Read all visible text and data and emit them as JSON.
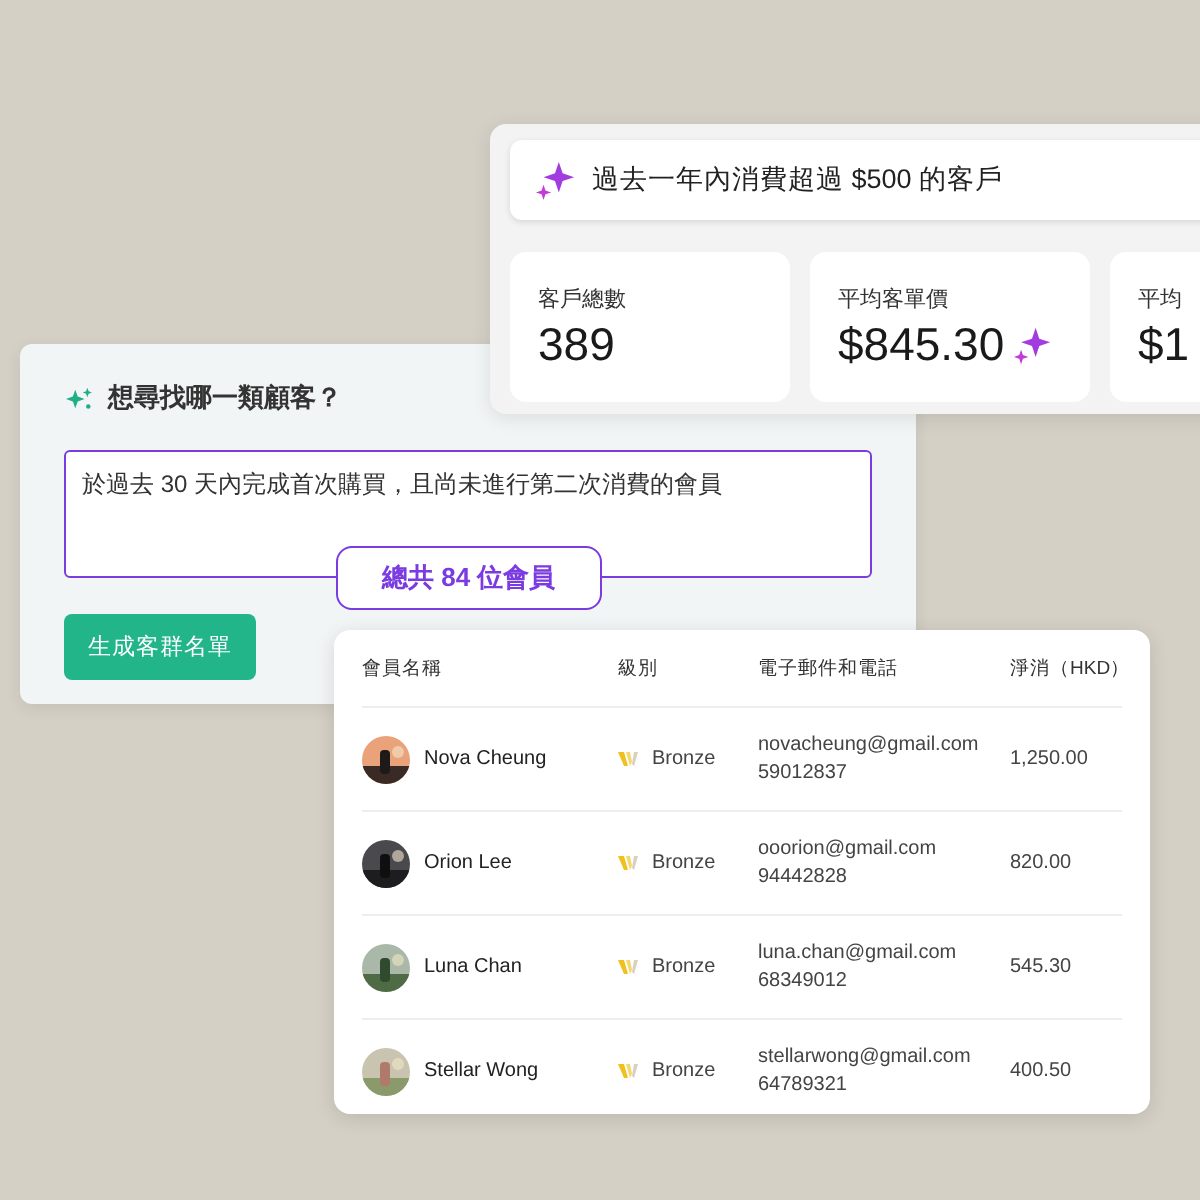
{
  "query_panel": {
    "query": "過去一年內消費超過 $500 的客戶",
    "stats": [
      {
        "label": "客戶總數",
        "value": "389",
        "sparkle": false
      },
      {
        "label": "平均客單價",
        "value": "$845.30",
        "sparkle": true
      },
      {
        "label": "平均",
        "value": "$1"
      }
    ]
  },
  "segment_panel": {
    "title": "想尋找哪一類顧客？",
    "prompt": "於過去 30 天內完成首次購買，且尚未進行第二次消費的會員",
    "result_badge": "總共 84 位會員",
    "button": "生成客群名單"
  },
  "member_table": {
    "columns": [
      "會員名稱",
      "級別",
      "電子郵件和電話",
      "淨消（HKD）"
    ],
    "rows": [
      {
        "name": "Nova Cheung",
        "tier": "Bronze",
        "email": "novacheung@gmail.com",
        "phone": "59012837",
        "net_spend": "1,250.00"
      },
      {
        "name": "Orion Lee",
        "tier": "Bronze",
        "email": "ooorion@gmail.com",
        "phone": "94442828",
        "net_spend": "820.00"
      },
      {
        "name": "Luna Chan",
        "tier": "Bronze",
        "email": "luna.chan@gmail.com",
        "phone": "68349012",
        "net_spend": "545.30"
      },
      {
        "name": "Stellar Wong",
        "tier": "Bronze",
        "email": "stellarwong@gmail.com",
        "phone": "64789321",
        "net_spend": "400.50"
      }
    ]
  }
}
